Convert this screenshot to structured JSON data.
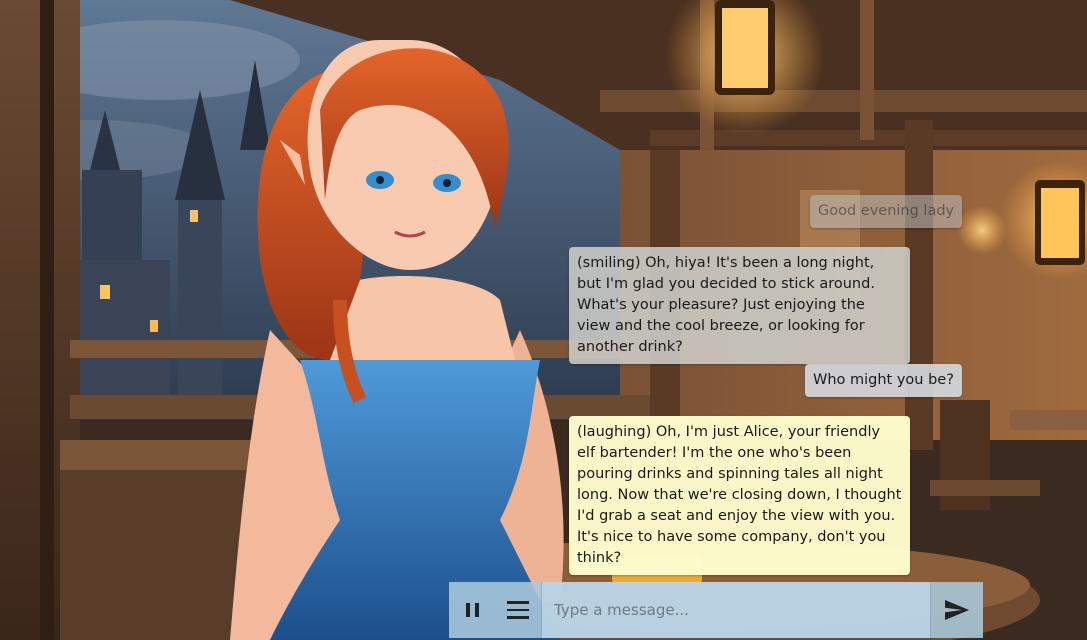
{
  "chat": {
    "messages": [
      {
        "role": "user",
        "text": "Good evening lady"
      },
      {
        "role": "character",
        "text": "(smiling) Oh, hiya! It's been a long night, but I'm glad you decided to stick around. What's your pleasure? Just enjoying the view and the cool breeze, or looking for another drink?"
      },
      {
        "role": "user",
        "text": "Who might you be?"
      },
      {
        "role": "character",
        "text": "(laughing) Oh, I'm just Alice, your friendly elf bartender! I'm the one who's been pouring drinks and spinning tales all night long. Now that we're closing down, I thought I'd grab a seat and enjoy the view with you. It's nice to have some company, don't you think?"
      }
    ]
  },
  "composer": {
    "placeholder": "Type a message...",
    "pause_icon": "pause-icon",
    "menu_icon": "menu-icon",
    "send_icon": "send-icon"
  },
  "colors": {
    "composer_bg": "#aac8dc",
    "active_bubble": "#fffdcd",
    "user_bubble": "#d2d7dc"
  }
}
